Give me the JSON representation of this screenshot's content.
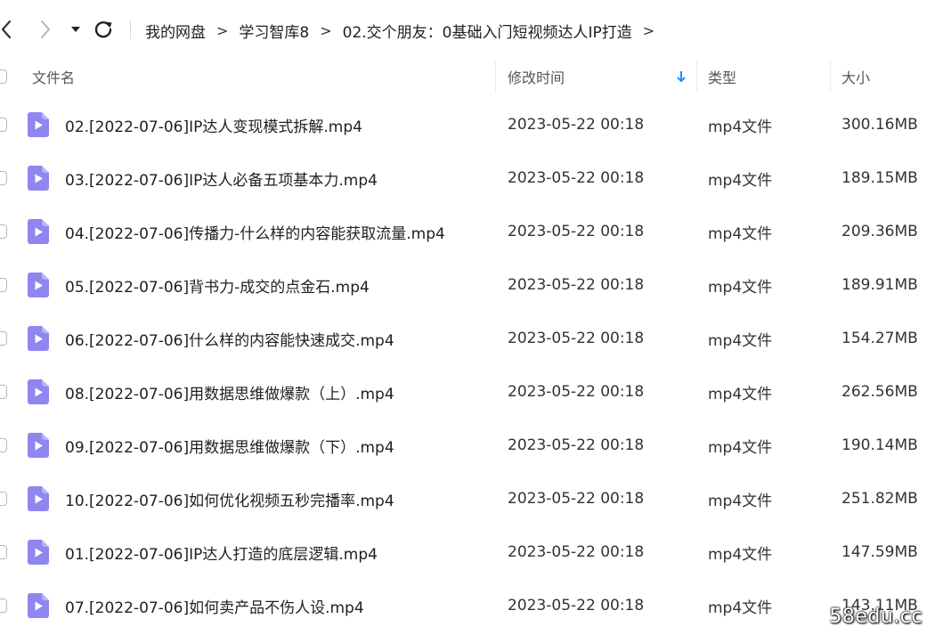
{
  "breadcrumb": [
    "我的网盘",
    "学习智库8",
    "02.交个朋友：0基础入门短视频达人IP打造"
  ],
  "breadcrumb_separator": ">",
  "columns": {
    "name": "文件名",
    "modified": "修改时间",
    "type": "类型",
    "size": "大小"
  },
  "sort": {
    "column": "modified",
    "direction": "desc"
  },
  "files": [
    {
      "name": "02.[2022-07-06]IP达人变现模式拆解.mp4",
      "modified": "2023-05-22 00:18",
      "type": "mp4文件",
      "size": "300.16MB"
    },
    {
      "name": "03.[2022-07-06]IP达人必备五项基本力.mp4",
      "modified": "2023-05-22 00:18",
      "type": "mp4文件",
      "size": "189.15MB"
    },
    {
      "name": "04.[2022-07-06]传播力-什么样的内容能获取流量.mp4",
      "modified": "2023-05-22 00:18",
      "type": "mp4文件",
      "size": "209.36MB"
    },
    {
      "name": "05.[2022-07-06]背书力-成交的点金石.mp4",
      "modified": "2023-05-22 00:18",
      "type": "mp4文件",
      "size": "189.91MB"
    },
    {
      "name": "06.[2022-07-06]什么样的内容能快速成交.mp4",
      "modified": "2023-05-22 00:18",
      "type": "mp4文件",
      "size": "154.27MB"
    },
    {
      "name": "08.[2022-07-06]用数据思维做爆款（上）.mp4",
      "modified": "2023-05-22 00:18",
      "type": "mp4文件",
      "size": "262.56MB"
    },
    {
      "name": "09.[2022-07-06]用数据思维做爆款（下）.mp4",
      "modified": "2023-05-22 00:18",
      "type": "mp4文件",
      "size": "190.14MB"
    },
    {
      "name": "10.[2022-07-06]如何优化视频五秒完播率.mp4",
      "modified": "2023-05-22 00:18",
      "type": "mp4文件",
      "size": "251.82MB"
    },
    {
      "name": "01.[2022-07-06]IP达人打造的底层逻辑.mp4",
      "modified": "2023-05-22 00:18",
      "type": "mp4文件",
      "size": "147.59MB"
    },
    {
      "name": "07.[2022-07-06]如何卖产品不伤人设.mp4",
      "modified": "2023-05-22 00:18",
      "type": "mp4文件",
      "size": "143.11MB"
    }
  ],
  "watermark": "58edu.cc",
  "colors": {
    "video_icon": "#8f86f0",
    "sort_arrow": "#1a8cff"
  },
  "icons": [
    "back-icon",
    "forward-icon",
    "dropdown-icon",
    "refresh-icon",
    "sort-down-icon",
    "video-file-icon"
  ]
}
